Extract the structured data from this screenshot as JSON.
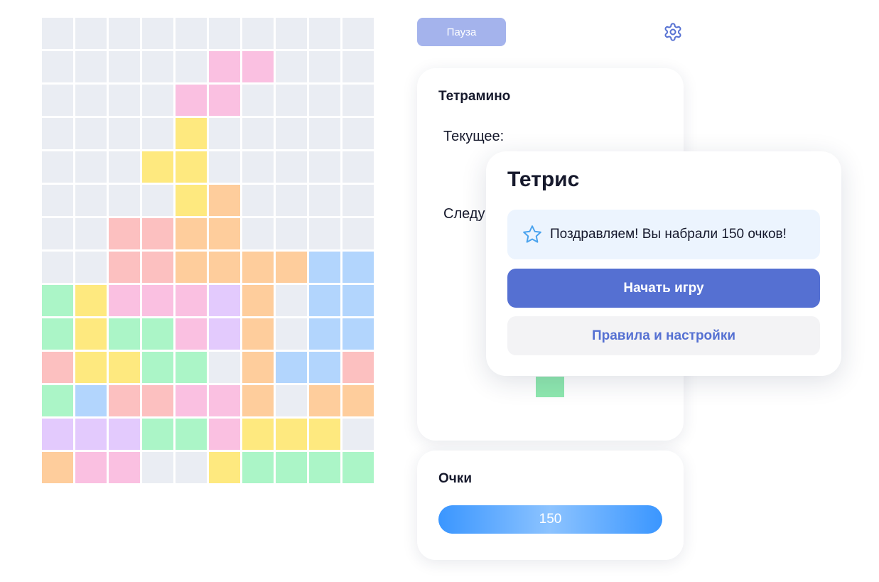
{
  "colors": {
    "empty": "#eaedf3",
    "pink": "#fac0e1",
    "yellow": "#fee97f",
    "orange": "#fecd9c",
    "red": "#fcc0c0",
    "blue": "#b2d5fd",
    "green": "#abf5c7",
    "purple": "#e3cafd",
    "accent": "#5570d2",
    "pause_bg": "#a4b3ec",
    "alert_bg": "#ecf4fe",
    "preview_green": "#8ee8af"
  },
  "board": {
    "columns": 10,
    "rows": [
      [
        "empty",
        "empty",
        "empty",
        "empty",
        "empty",
        "empty",
        "empty",
        "empty",
        "empty",
        "empty"
      ],
      [
        "empty",
        "empty",
        "empty",
        "empty",
        "empty",
        "pink",
        "pink",
        "empty",
        "empty",
        "empty"
      ],
      [
        "empty",
        "empty",
        "empty",
        "empty",
        "pink",
        "pink",
        "empty",
        "empty",
        "empty",
        "empty"
      ],
      [
        "empty",
        "empty",
        "empty",
        "empty",
        "yellow",
        "empty",
        "empty",
        "empty",
        "empty",
        "empty"
      ],
      [
        "empty",
        "empty",
        "empty",
        "yellow",
        "yellow",
        "empty",
        "empty",
        "empty",
        "empty",
        "empty"
      ],
      [
        "empty",
        "empty",
        "empty",
        "empty",
        "yellow",
        "orange",
        "empty",
        "empty",
        "empty",
        "empty"
      ],
      [
        "empty",
        "empty",
        "red",
        "red",
        "orange",
        "orange",
        "empty",
        "empty",
        "empty",
        "empty"
      ],
      [
        "empty",
        "empty",
        "red",
        "red",
        "orange",
        "orange",
        "orange",
        "orange",
        "blue",
        "blue"
      ],
      [
        "green",
        "yellow",
        "pink",
        "pink",
        "pink",
        "purple",
        "orange",
        "empty",
        "blue",
        "blue"
      ],
      [
        "green",
        "yellow",
        "green",
        "green",
        "pink",
        "purple",
        "orange",
        "empty",
        "blue",
        "blue"
      ],
      [
        "red",
        "yellow",
        "yellow",
        "green",
        "green",
        "empty",
        "orange",
        "blue",
        "blue",
        "red"
      ],
      [
        "green",
        "blue",
        "red",
        "red",
        "pink",
        "pink",
        "orange",
        "empty",
        "orange",
        "orange"
      ],
      [
        "purple",
        "purple",
        "purple",
        "green",
        "green",
        "pink",
        "yellow",
        "yellow",
        "yellow",
        "empty"
      ],
      [
        "orange",
        "pink",
        "pink",
        "empty",
        "empty",
        "yellow",
        "green",
        "green",
        "green",
        "green"
      ]
    ]
  },
  "toolbar": {
    "pause_label": "Пауза",
    "settings_icon": "gear-icon"
  },
  "tetromino_card": {
    "title": "Тетрамино",
    "current_label": "Текущее:",
    "next_label": "Следу"
  },
  "score_card": {
    "title": "Очки",
    "value": "150"
  },
  "modal": {
    "title": "Тетрис",
    "alert_icon": "star-icon",
    "alert_text": "Поздравляем! Вы набрали 150 очков!",
    "start_label": "Начать игру",
    "rules_label": "Правила и настройки"
  }
}
